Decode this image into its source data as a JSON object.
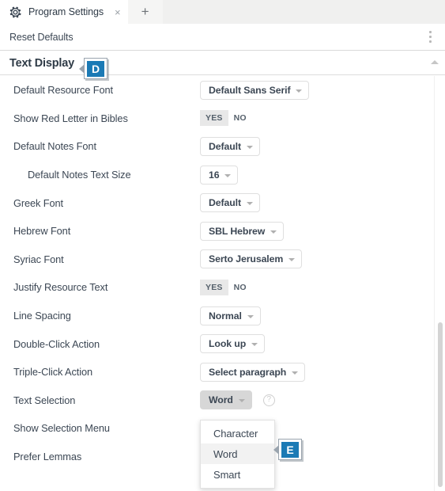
{
  "window": {
    "tab": {
      "icon": "gear-icon",
      "title": "Program Settings",
      "close": "×"
    },
    "new_tab": "+"
  },
  "toolbar": {
    "reset_defaults": "Reset Defaults",
    "overflow_menu": "more-options"
  },
  "section": {
    "title": "Text Display"
  },
  "callouts": [
    {
      "id": "D",
      "label": "D"
    },
    {
      "id": "E",
      "label": "E"
    }
  ],
  "settings": {
    "rows": [
      {
        "label": "Default Resource Font",
        "type": "dropdown",
        "value": "Default Sans Serif"
      },
      {
        "label": "Show Red Letter in Bibles",
        "type": "toggle",
        "yes": "YES",
        "no": "NO",
        "selected": "YES"
      },
      {
        "label": "Default Notes Font",
        "type": "dropdown",
        "value": "Default"
      },
      {
        "label": "Default Notes Text Size",
        "type": "dropdown",
        "value": "16",
        "indent": true
      },
      {
        "label": "Greek Font",
        "type": "dropdown",
        "value": "Default"
      },
      {
        "label": "Hebrew Font",
        "type": "dropdown",
        "value": "SBL Hebrew"
      },
      {
        "label": "Syriac Font",
        "type": "dropdown",
        "value": "Serto Jerusalem"
      },
      {
        "label": "Justify Resource Text",
        "type": "toggle",
        "yes": "YES",
        "no": "NO",
        "selected": "YES"
      },
      {
        "label": "Line Spacing",
        "type": "dropdown",
        "value": "Normal"
      },
      {
        "label": "Double-Click Action",
        "type": "dropdown",
        "value": "Look up"
      },
      {
        "label": "Triple-Click Action",
        "type": "dropdown",
        "value": "Select paragraph"
      },
      {
        "label": "Text Selection",
        "type": "dropdown",
        "value": "Word",
        "active": true,
        "help": "?"
      },
      {
        "label": "Show Selection Menu",
        "type": "none"
      },
      {
        "label": "Prefer Lemmas",
        "type": "none"
      }
    ]
  },
  "open_menu": {
    "owner": "Text Selection",
    "items": [
      {
        "label": "Character",
        "selected": false
      },
      {
        "label": "Word",
        "selected": true
      },
      {
        "label": "Smart",
        "selected": false
      }
    ]
  },
  "colors": {
    "accent": "#1b7ab5",
    "text": "#3c4754",
    "heading": "#2f3b47",
    "border": "#dfdfdf",
    "toggle_on_bg": "#e8e8e8",
    "active_control_bg": "#d7d7d7"
  }
}
